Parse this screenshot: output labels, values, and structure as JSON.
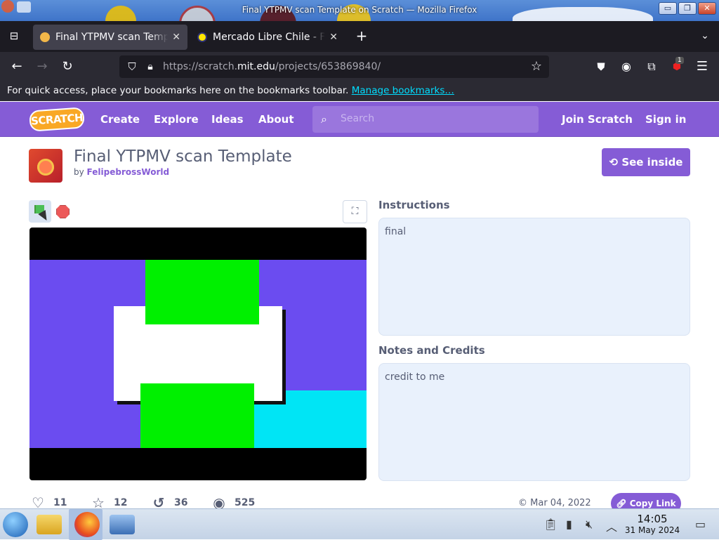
{
  "os": {
    "window_title": "Final YTPMV scan Template on Scratch — Mozilla Firefox",
    "buttons": {
      "minimize": "▭",
      "maximize": "❐",
      "close": "✕"
    }
  },
  "browser": {
    "tabs": [
      {
        "label": "Final YTPMV scan Template on Scratch",
        "active": true
      },
      {
        "label": "Mercado Libre Chile - Free shipping",
        "active": false
      }
    ],
    "new_tab": "+",
    "url_host_prefix": "https://scratch.",
    "url_host": "mit.edu",
    "url_path": "/projects/653869840/",
    "bookmarks_text": "For quick access, place your bookmarks here on the bookmarks toolbar.",
    "bookmarks_link": "Manage bookmarks…",
    "extension_badge": "1"
  },
  "scratch_nav": {
    "logo": "SCRATCH",
    "links": [
      "Create",
      "Explore",
      "Ideas",
      "About"
    ],
    "search_placeholder": "Search",
    "join": "Join Scratch",
    "sign_in": "Sign in"
  },
  "project": {
    "title": "Final YTPMV scan Template",
    "by_label": "by",
    "author": "FelipebrossWorld",
    "see_inside": "See inside",
    "instructions_title": "Instructions",
    "instructions": "final",
    "notes_title": "Notes and Credits",
    "notes": "credit to me",
    "stats": {
      "loves": "11",
      "favorites": "12",
      "remixes": "36",
      "views": "525"
    },
    "date": "Mar 04, 2022",
    "copy_link": "Copy Link"
  },
  "taskbar": {
    "time": "14:05",
    "date": "31 May 2024"
  },
  "colors": {
    "scratch_purple": "#855cd6",
    "stage_bg": "#6b4cf0",
    "green": "#00f000",
    "cyan": "#00e5f5"
  },
  "icons": [
    "start-orb-icon",
    "file-manager-icon",
    "firefox-icon",
    "system-monitor-icon",
    "clipboard-icon",
    "battery-icon",
    "mute-icon",
    "chevron-up-icon",
    "show-desktop-icon"
  ]
}
